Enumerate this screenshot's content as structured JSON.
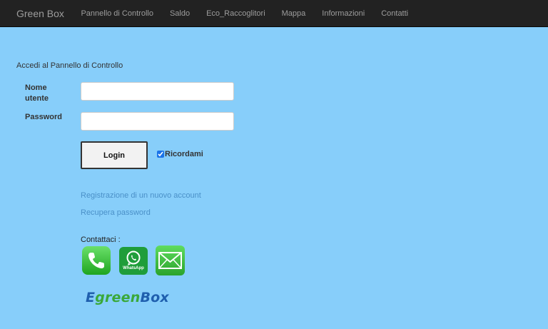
{
  "navbar": {
    "brand": "Green Box",
    "links": [
      "Pannello di Controllo",
      "Saldo",
      "Eco_Raccoglitori",
      "Mappa",
      "Informazioni",
      "Contatti"
    ]
  },
  "login": {
    "intro": "Accedi al Pannello di Controllo",
    "username_label": "Nome utente",
    "username_value": "",
    "password_label": "Password",
    "password_value": "",
    "button_label": "Login",
    "remember_label": "Ricordami",
    "remember_checked": true
  },
  "links": {
    "register": "Registrazione di un nuovo account",
    "recover": "Recupera password"
  },
  "contacts": {
    "label": "Contattaci :",
    "whatsapp_text": "WhatsApp",
    "icons": [
      "phone-icon",
      "whatsapp-icon",
      "mail-icon"
    ]
  },
  "logo": {
    "part1": "E",
    "part2": "green",
    "part3": "Box"
  },
  "colors": {
    "background": "#87cefa",
    "navbar": "#222222",
    "link": "#4a90c8"
  }
}
